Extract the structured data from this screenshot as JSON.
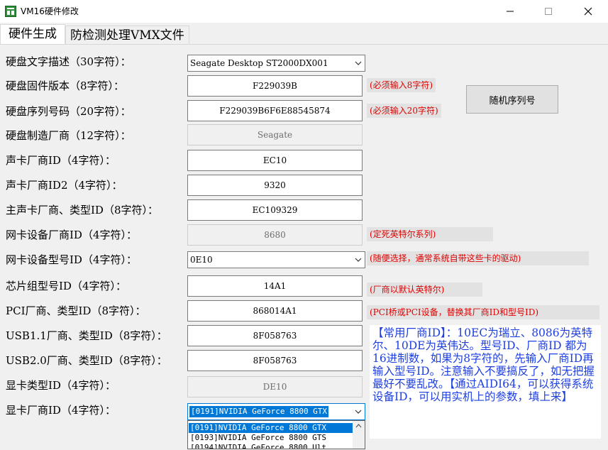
{
  "window": {
    "title": "VM16硬件修改",
    "minimize_glyph": "—",
    "maximize_glyph": "☐",
    "close_glyph": "✕"
  },
  "tabs": [
    {
      "label": "硬件生成",
      "active": true
    },
    {
      "label": "防检测处理VMX文件",
      "active": false
    }
  ],
  "form": {
    "disk_desc": {
      "label": "硬盘文字描述（30字符）：",
      "value": "Seagate Desktop ST2000DX001"
    },
    "disk_fw": {
      "label": "硬盘固件版本（8字符）：",
      "value": "F229039B",
      "note": "(必须输入8字符)"
    },
    "disk_serial": {
      "label": "硬盘序列号码（20字符）：",
      "value": "F229039B6F6E88545874",
      "note": "(必须输入20字符)"
    },
    "disk_vendor": {
      "label": "硬盘制造厂商（12字符）：",
      "value": "Seagate"
    },
    "sound_vendor": {
      "label": "声卡厂商ID（4字符）：",
      "value": "EC10"
    },
    "sound_vendor2": {
      "label": "声卡厂商ID2（4字符）：",
      "value": "9320"
    },
    "main_sound": {
      "label": "主声卡厂商、类型ID（8字符）：",
      "value": "EC109329"
    },
    "nic_vendor": {
      "label": "网卡设备厂商ID（4字符）：",
      "value": "8680",
      "note": "(定死英特尔系列)"
    },
    "nic_model": {
      "label": "网卡设备型号ID（4字符）：",
      "value": "0E10",
      "note": "(随便选择，通常系统自带这些卡的驱动)"
    },
    "chipset": {
      "label": "芯片组型号ID（4字符）：",
      "value": "14A1",
      "note": "(厂商以默认英特尔)"
    },
    "pci": {
      "label": "PCI厂商、类型ID（8字符）：",
      "value": "868014A1",
      "note": "(PCI桥或PCI设备，替换其厂商ID和型号ID)"
    },
    "usb11": {
      "label": "USB1.1厂商、类型ID（8字符）：",
      "value": "8F058763"
    },
    "usb20": {
      "label": "USB2.0厂商、类型ID（8字符）：",
      "value": "8F058763"
    },
    "gpu_type": {
      "label": "显卡类型ID（4字符）：",
      "value": "DE10"
    },
    "gpu_vendor": {
      "label": "显卡厂商ID（4字符）：",
      "value": "[0191]NVIDIA GeForce 8800 GTX"
    }
  },
  "random_serial_button": "随机序列号",
  "gpu_options": [
    "[0191]NVIDIA GeForce 8800 GTX",
    "[0193]NVIDIA GeForce 8800 GTS",
    "[0194]NVIDIA GeForce 8800 Ult"
  ],
  "info_text": "【常用厂商ID】：10EC为瑞立、8086为英特尔、10DE为英伟达。型号ID、厂商ID 都为16进制数，如果为8字符的，先输入厂商ID再输入型号ID。注意输入不要搞反了，如无把握最好不要乱改。【通过AIDI64，可以获得系统设备ID，可以用实机上的参数，填上来】",
  "colors": {
    "accent": "#0078d7",
    "note_red": "#e00000",
    "info_blue": "#1e3fe0",
    "background": "#f0f0f0"
  },
  "icons": {
    "app": "app-icon",
    "dropdown": "chevron-down-icon"
  }
}
